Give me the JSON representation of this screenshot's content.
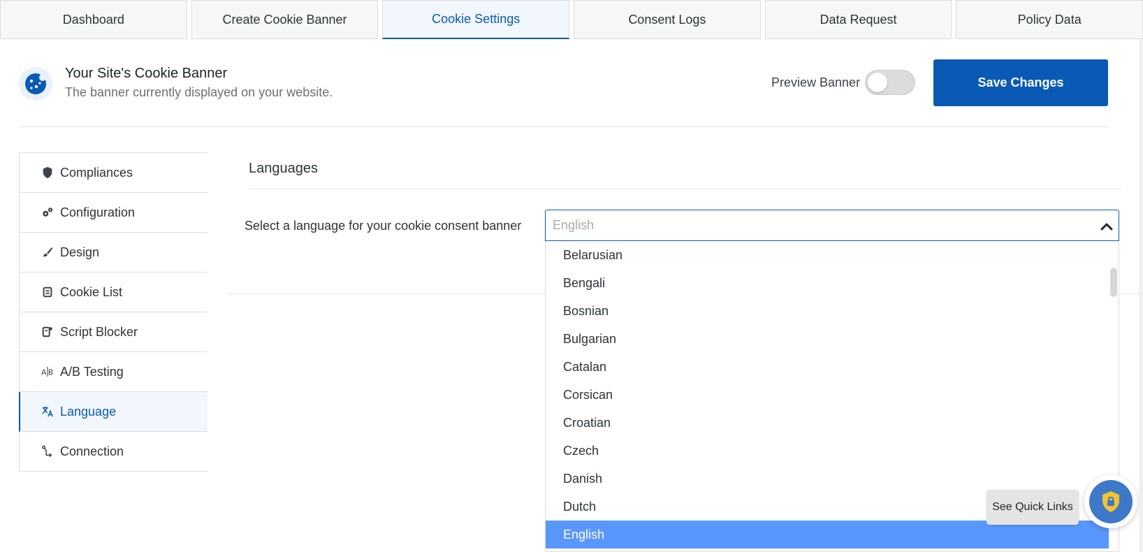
{
  "tabs": [
    {
      "label": "Dashboard"
    },
    {
      "label": "Create Cookie Banner"
    },
    {
      "label": "Cookie Settings",
      "active": true
    },
    {
      "label": "Consent Logs"
    },
    {
      "label": "Data Request"
    },
    {
      "label": "Policy Data"
    }
  ],
  "header": {
    "title": "Your Site's Cookie Banner",
    "subtitle": "The banner currently displayed on your website.",
    "preview_label": "Preview Banner",
    "preview_enabled": false,
    "save_label": "Save Changes",
    "logo_icon": "cookie-icon"
  },
  "sidebar": {
    "items": [
      {
        "label": "Compliances",
        "icon": "shield-icon"
      },
      {
        "label": "Configuration",
        "icon": "gears-icon"
      },
      {
        "label": "Design",
        "icon": "brush-icon"
      },
      {
        "label": "Cookie List",
        "icon": "scroll-icon"
      },
      {
        "label": "Script Blocker",
        "icon": "script-blocker-icon"
      },
      {
        "label": "A/B Testing",
        "icon": "ab-icon"
      },
      {
        "label": "Language",
        "icon": "translate-icon",
        "active": true
      },
      {
        "label": "Connection",
        "icon": "connection-icon"
      }
    ]
  },
  "main": {
    "section_title": "Languages",
    "field_label": "Select a language for your cookie consent banner",
    "select": {
      "placeholder": "English",
      "options": [
        "Belarusian",
        "Bengali",
        "Bosnian",
        "Bulgarian",
        "Catalan",
        "Corsican",
        "Croatian",
        "Czech",
        "Danish",
        "Dutch",
        "English"
      ],
      "selected": "English"
    }
  },
  "quick_links": {
    "label": "See Quick Links",
    "icon": "shield-lock-icon"
  },
  "colors": {
    "accent": "#0a59b5",
    "selected_option": "#5897fb"
  }
}
